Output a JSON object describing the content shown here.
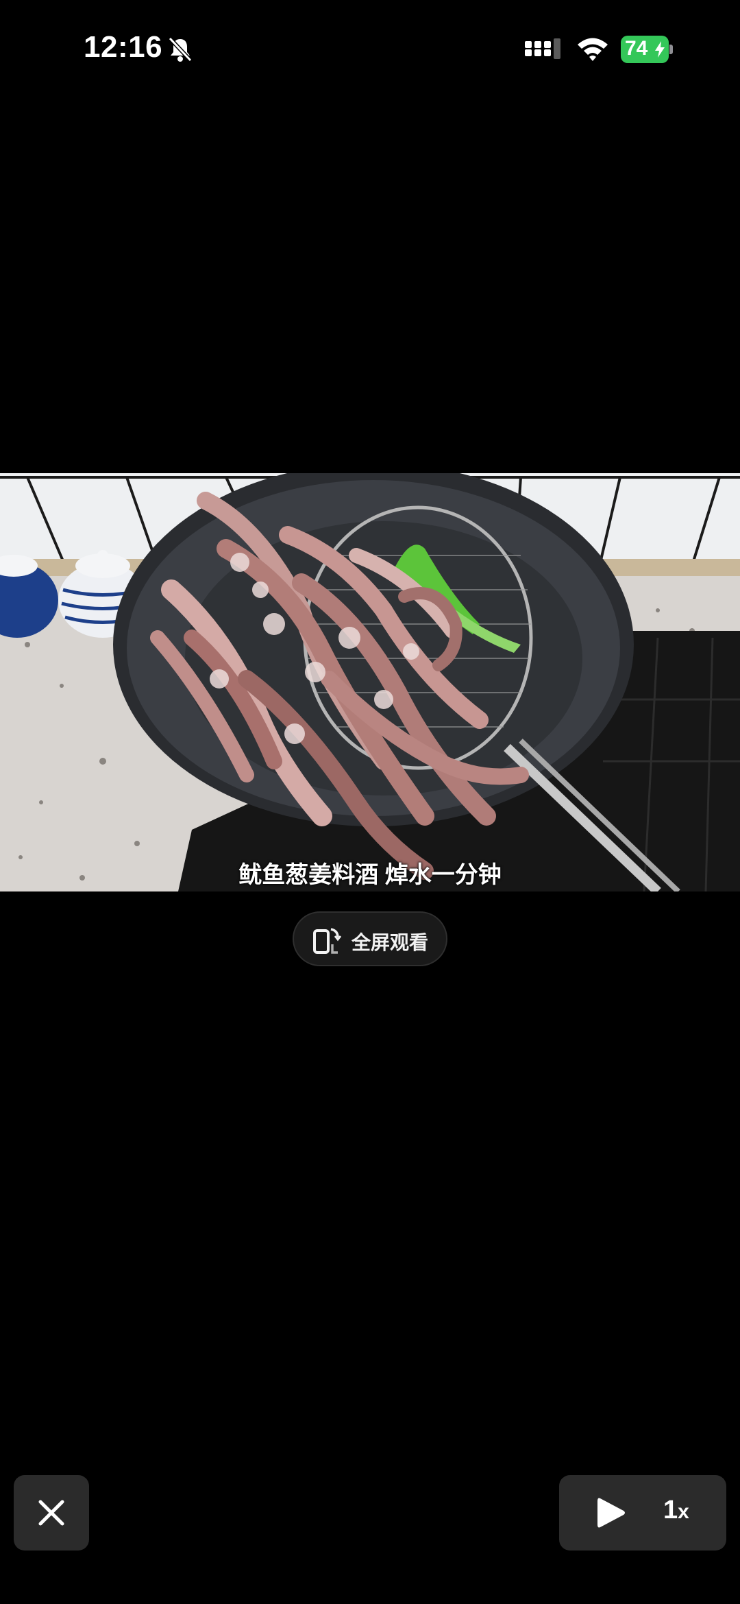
{
  "status_bar": {
    "time": "12:16",
    "battery_level": "74",
    "icons": [
      "bell-muted-icon",
      "cellular-signal-icon",
      "wifi-icon",
      "battery-charging-icon"
    ]
  },
  "video": {
    "subtitle": "鱿鱼葱姜料酒 焯水一分钟"
  },
  "fullscreen_button": {
    "label": "全屏观看",
    "icon": "rotate-phone-icon"
  },
  "controls": {
    "close_icon": "close-icon",
    "play_icon": "play-icon",
    "speed_value": "1",
    "speed_suffix": "x"
  },
  "colors": {
    "background": "#000000",
    "battery_green": "#34c759",
    "control_bg": "#2b2b2b"
  }
}
